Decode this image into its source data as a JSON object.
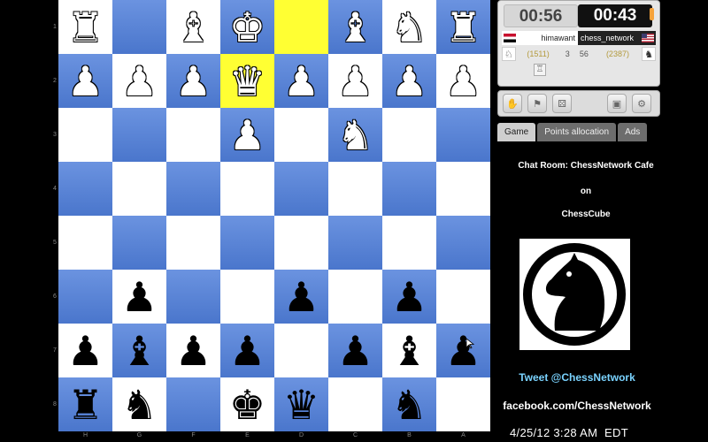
{
  "board": {
    "ranks": [
      "1",
      "2",
      "3",
      "4",
      "5",
      "6",
      "7",
      "8"
    ],
    "files": [
      "H",
      "G",
      "F",
      "E",
      "D",
      "C",
      "B",
      "A"
    ],
    "highlight": [
      [
        0,
        4
      ],
      [
        1,
        3
      ]
    ],
    "pieces": [
      {
        "r": 0,
        "c": 0,
        "g": "♜",
        "side": "w",
        "name": "white-rook"
      },
      {
        "r": 0,
        "c": 2,
        "g": "♝",
        "side": "w",
        "name": "white-bishop"
      },
      {
        "r": 0,
        "c": 3,
        "g": "♚",
        "side": "w",
        "name": "white-king"
      },
      {
        "r": 0,
        "c": 5,
        "g": "♝",
        "side": "w",
        "name": "white-bishop"
      },
      {
        "r": 0,
        "c": 6,
        "g": "♞",
        "side": "w",
        "name": "white-knight"
      },
      {
        "r": 0,
        "c": 7,
        "g": "♜",
        "side": "w",
        "name": "white-rook"
      },
      {
        "r": 1,
        "c": 0,
        "g": "♟",
        "side": "w",
        "name": "white-pawn"
      },
      {
        "r": 1,
        "c": 1,
        "g": "♟",
        "side": "w",
        "name": "white-pawn"
      },
      {
        "r": 1,
        "c": 2,
        "g": "♟",
        "side": "w",
        "name": "white-pawn"
      },
      {
        "r": 1,
        "c": 3,
        "g": "♛",
        "side": "w",
        "name": "white-queen"
      },
      {
        "r": 1,
        "c": 4,
        "g": "♟",
        "side": "w",
        "name": "white-pawn"
      },
      {
        "r": 1,
        "c": 5,
        "g": "♟",
        "side": "w",
        "name": "white-pawn"
      },
      {
        "r": 1,
        "c": 6,
        "g": "♟",
        "side": "w",
        "name": "white-pawn"
      },
      {
        "r": 1,
        "c": 7,
        "g": "♟",
        "side": "w",
        "name": "white-pawn"
      },
      {
        "r": 2,
        "c": 3,
        "g": "♟",
        "side": "w",
        "name": "white-pawn"
      },
      {
        "r": 2,
        "c": 5,
        "g": "♞",
        "side": "w",
        "name": "white-knight"
      },
      {
        "r": 5,
        "c": 1,
        "g": "♟",
        "side": "b",
        "name": "black-pawn"
      },
      {
        "r": 5,
        "c": 4,
        "g": "♟",
        "side": "b",
        "name": "black-pawn"
      },
      {
        "r": 5,
        "c": 6,
        "g": "♟",
        "side": "b",
        "name": "black-pawn"
      },
      {
        "r": 6,
        "c": 0,
        "g": "♟",
        "side": "b",
        "name": "black-pawn"
      },
      {
        "r": 6,
        "c": 1,
        "g": "♝",
        "side": "b",
        "name": "black-bishop"
      },
      {
        "r": 6,
        "c": 2,
        "g": "♟",
        "side": "b",
        "name": "black-pawn"
      },
      {
        "r": 6,
        "c": 3,
        "g": "♟",
        "side": "b",
        "name": "black-pawn"
      },
      {
        "r": 6,
        "c": 5,
        "g": "♟",
        "side": "b",
        "name": "black-pawn"
      },
      {
        "r": 6,
        "c": 6,
        "g": "♝",
        "side": "b",
        "name": "black-bishop"
      },
      {
        "r": 6,
        "c": 7,
        "g": "♟",
        "side": "b",
        "name": "black-pawn"
      },
      {
        "r": 7,
        "c": 0,
        "g": "♜",
        "side": "b",
        "name": "black-rook"
      },
      {
        "r": 7,
        "c": 1,
        "g": "♞",
        "side": "b",
        "name": "black-knight"
      },
      {
        "r": 7,
        "c": 3,
        "g": "♚",
        "side": "b",
        "name": "black-king"
      },
      {
        "r": 7,
        "c": 4,
        "g": "♛",
        "side": "b",
        "name": "black-queen"
      },
      {
        "r": 7,
        "c": 6,
        "g": "♞",
        "side": "b",
        "name": "black-knight"
      }
    ]
  },
  "clocks": {
    "white": "00:56",
    "black": "00:43"
  },
  "players": {
    "left": {
      "name": "himawant",
      "rating": "(1511)",
      "score": "3",
      "flag_icon": "egypt-flag-icon"
    },
    "right": {
      "name": "chess_network",
      "rating": "(2387)",
      "score": "56",
      "flag_icon": "usa-flag-icon"
    }
  },
  "toolbar": {
    "icons": [
      "handshake-icon",
      "resign-icon",
      "dice-icon",
      "save-icon",
      "settings-icon"
    ]
  },
  "tabs": [
    {
      "label": "Game",
      "active": true
    },
    {
      "label": "Points allocation",
      "active": false
    },
    {
      "label": "Ads",
      "active": false
    }
  ],
  "chat": {
    "line1": "Chat Room: ChessNetwork Cafe",
    "line2": "on",
    "line3": "ChessCube"
  },
  "social": {
    "twitter": "Tweet @ChessNetwork",
    "facebook": "facebook.com/ChessNetwork"
  },
  "timestamp": {
    "date": "4/25/12",
    "time": "3:28 AM",
    "zone": "EDT"
  },
  "colors": {
    "dark_square": "#5a84d8",
    "light_square": "#ffffff",
    "highlight": "#ffff33",
    "twitter": "#7ad3ff"
  }
}
